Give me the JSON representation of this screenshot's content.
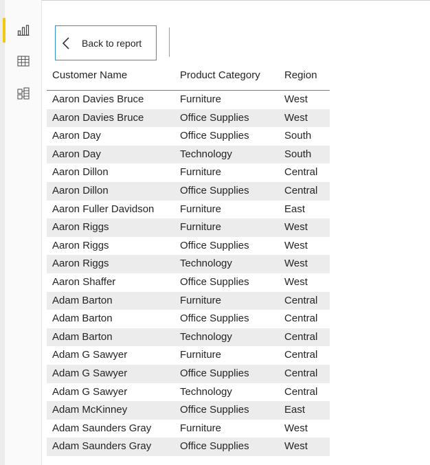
{
  "sidebar": {
    "icons": [
      {
        "name": "report-view-icon",
        "active": true
      },
      {
        "name": "data-view-icon",
        "active": false
      },
      {
        "name": "model-view-icon",
        "active": false
      }
    ],
    "accent_color": "#f2c811"
  },
  "toolbar": {
    "back_label": "Back to report"
  },
  "table": {
    "headers": [
      "Customer Name",
      "Product Category",
      "Region"
    ],
    "rows": [
      [
        "Aaron Davies Bruce",
        "Furniture",
        "West"
      ],
      [
        "Aaron Davies Bruce",
        "Office Supplies",
        "West"
      ],
      [
        "Aaron Day",
        "Office Supplies",
        "South"
      ],
      [
        "Aaron Day",
        "Technology",
        "South"
      ],
      [
        "Aaron Dillon",
        "Furniture",
        "Central"
      ],
      [
        "Aaron Dillon",
        "Office Supplies",
        "Central"
      ],
      [
        "Aaron Fuller Davidson",
        "Furniture",
        "East"
      ],
      [
        "Aaron Riggs",
        "Furniture",
        "West"
      ],
      [
        "Aaron Riggs",
        "Office Supplies",
        "West"
      ],
      [
        "Aaron Riggs",
        "Technology",
        "West"
      ],
      [
        "Aaron Shaffer",
        "Office Supplies",
        "West"
      ],
      [
        "Adam Barton",
        "Furniture",
        "Central"
      ],
      [
        "Adam Barton",
        "Office Supplies",
        "Central"
      ],
      [
        "Adam Barton",
        "Technology",
        "Central"
      ],
      [
        "Adam G Sawyer",
        "Furniture",
        "Central"
      ],
      [
        "Adam G Sawyer",
        "Office Supplies",
        "Central"
      ],
      [
        "Adam G Sawyer",
        "Technology",
        "Central"
      ],
      [
        "Adam McKinney",
        "Office Supplies",
        "East"
      ],
      [
        "Adam Saunders Gray",
        "Furniture",
        "West"
      ],
      [
        "Adam Saunders Gray",
        "Office Supplies",
        "West"
      ]
    ],
    "header_border_color": "#2f8fd6",
    "alt_row_color": "#ececec"
  }
}
